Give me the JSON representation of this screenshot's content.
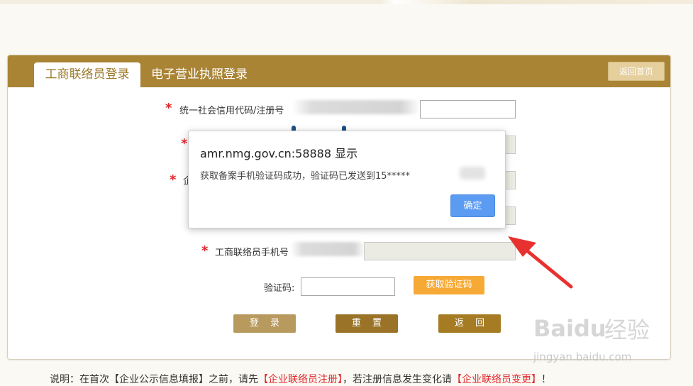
{
  "header": {
    "tab_active": "工商联络员登录",
    "tab_inactive": "电子营业执照登录",
    "home_button": "返回首页"
  },
  "form": {
    "credit_code_label": "统一社会信用代码/注册号",
    "phone_label": "工商联络员手机号",
    "enterprise_label_partial": "企",
    "captcha_label": "验证码:",
    "get_code_button": "获取验证码",
    "login_button": "登 录",
    "reset_button": "重 置",
    "back_button": "返 回"
  },
  "dialog": {
    "title": "amr.nmg.gov.cn:58888 显示",
    "message": "获取备案手机验证码成功，验证码已发送到15*****",
    "ok_button": "确定"
  },
  "note": {
    "prefix": "说明：在首次【企业公示信息填报】之前，请先",
    "link1": "【企业联络员注册】",
    "middle": "，若注册信息发生变化请",
    "link2": "【企业联络员变更】",
    "suffix": "！"
  },
  "watermark": {
    "logo": "Baidu",
    "jingyan": "经验",
    "url": "jingyan.baidu.com"
  },
  "colors": {
    "header_bg": "#a98435",
    "required_star": "#e0292d",
    "sms_button": "#f7a935",
    "dialog_ok": "#5b9bf1",
    "arrow": "#e8312f"
  }
}
